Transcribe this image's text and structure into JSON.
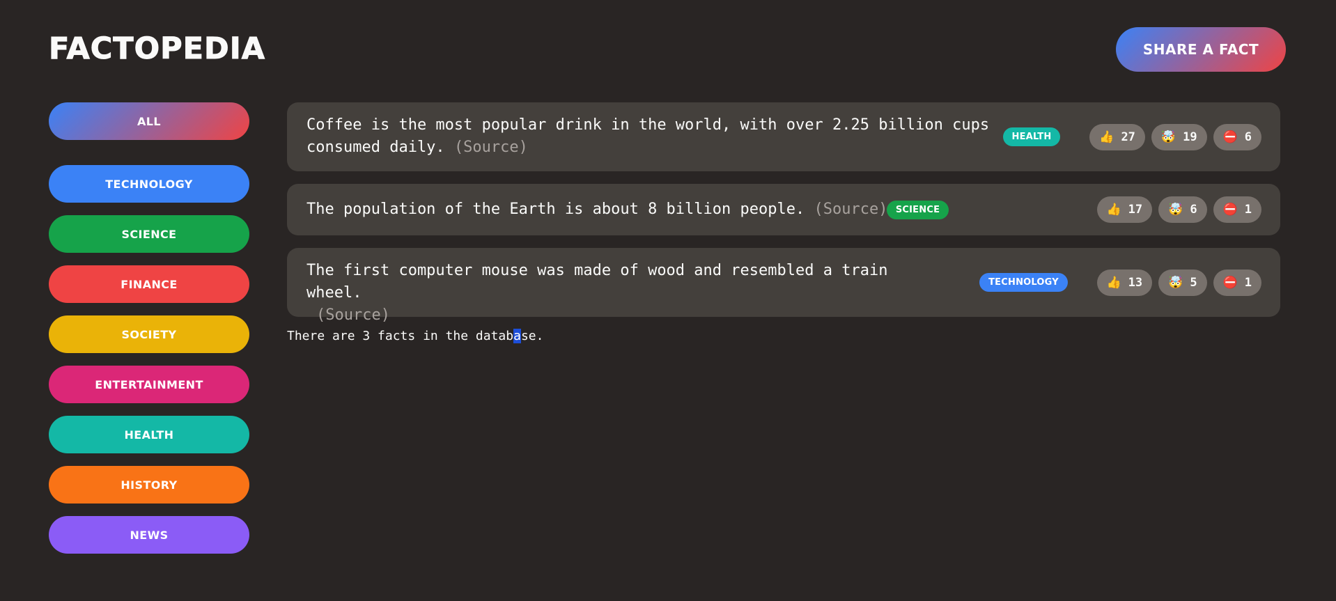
{
  "header": {
    "title": "FACTOPEDIA",
    "share_label": "SHARE A FACT"
  },
  "sidebar": {
    "items": [
      {
        "label": "ALL",
        "color": "gradient"
      },
      {
        "label": "TECHNOLOGY",
        "color": "#3b82f6"
      },
      {
        "label": "SCIENCE",
        "color": "#16a34a"
      },
      {
        "label": "FINANCE",
        "color": "#ef4444"
      },
      {
        "label": "SOCIETY",
        "color": "#eab308"
      },
      {
        "label": "ENTERTAINMENT",
        "color": "#db2777"
      },
      {
        "label": "HEALTH",
        "color": "#14b8a6"
      },
      {
        "label": "HISTORY",
        "color": "#f97316"
      },
      {
        "label": "NEWS",
        "color": "#8b5cf6"
      }
    ]
  },
  "facts": [
    {
      "text_line1": "Coffee is the most popular drink in the world, with over 2.25 billion cups",
      "text_line2": "consumed daily.",
      "source": "(Source)",
      "category": "HEALTH",
      "category_color": "#14b8a6",
      "votes": {
        "interesting": "27",
        "mindblowing": "19",
        "false": "6"
      }
    },
    {
      "text_line1": "The population of the Earth is about 8 billion people.",
      "source": "(Source)",
      "category": "SCIENCE",
      "category_color": "#16a34a",
      "votes": {
        "interesting": "17",
        "mindblowing": "6",
        "false": "1"
      }
    },
    {
      "text_line1": "The first computer mouse was made of wood and resembled a train wheel.",
      "source": "(Source)",
      "category": "TECHNOLOGY",
      "category_color": "#3b82f6",
      "votes": {
        "interesting": "13",
        "mindblowing": "5",
        "false": "1"
      }
    }
  ],
  "icons": {
    "interesting": "thumbs-up-icon",
    "mindblowing": "mind-blown-icon",
    "false": "no-entry-icon"
  },
  "footer": {
    "count_before": "There are 3 facts in the datab",
    "count_selected": "a",
    "count_after": "se."
  }
}
